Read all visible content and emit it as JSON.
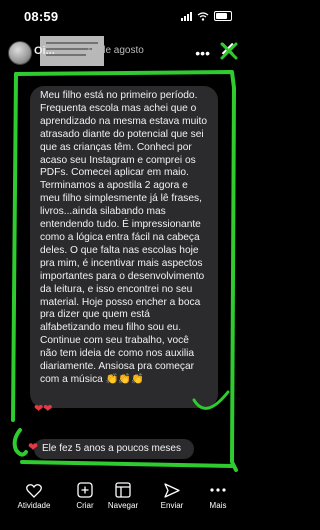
{
  "status_bar": {
    "time": "08:59"
  },
  "story": {
    "username": "Oi...",
    "date": "12 de agosto"
  },
  "message": {
    "text": "Meu filho está no primeiro período. Frequenta escola mas achei que o aprendizado na mesma estava muito atrasado diante do potencial que sei que as crianças têm. Conheci por acaso seu Instagram e comprei os PDFs. Comecei aplicar em maio. Terminamos a apostila 2 agora e meu filho simplesmente já lê frases, livros...ainda silabando mas entendendo tudo. É impressionante como a lógica entra fácil na cabeça deles. O que falta nas escolas hoje pra mim, é incentivar mais aspectos importantes para o desenvolvimento da leitura, e isso encontrei no seu material. Hoje posso encher a boca pra dizer que quem está alfabetizando meu filho sou eu. Continue com seu trabalho, você não tem ideia de como nos auxilia diariamente. Ansiosa pra começar com a música 👏👏👏",
    "reply": "Ele fez 5 anos a poucos meses"
  },
  "bottom_nav": {
    "items": [
      {
        "label": "Atividade",
        "icon": "heart-icon"
      },
      {
        "label": "Criar",
        "icon": "plus-square-icon"
      },
      {
        "label": "Navegar",
        "icon": "browse-icon"
      },
      {
        "label": "Enviar",
        "icon": "send-icon"
      },
      {
        "label": "Mais",
        "icon": "more-icon"
      }
    ]
  },
  "colors": {
    "highlight": "#2ecc2e",
    "bubble": "#2b2b2d",
    "heart": "#e63946"
  }
}
